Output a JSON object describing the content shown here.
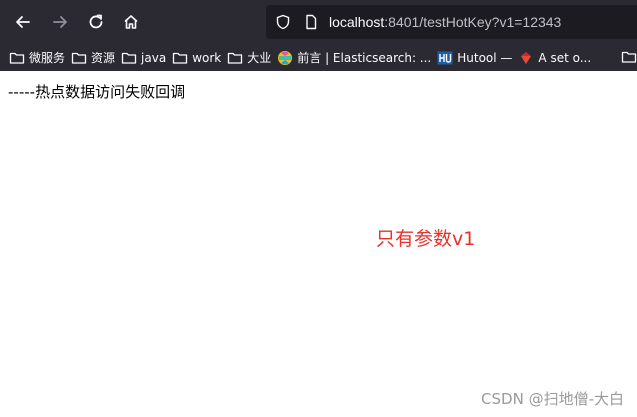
{
  "browser": {
    "url": {
      "host": "localhost",
      "rest": ":8401/testHotKey?v1=12343"
    },
    "icons": {
      "back": "arrow-left-icon",
      "forward": "arrow-right-icon",
      "reload": "reload-icon",
      "home": "home-icon",
      "tracking": "shield-icon",
      "page": "page-icon"
    },
    "bookmarks": [
      {
        "label": "微服务",
        "icon": "folder-icon"
      },
      {
        "label": "资源",
        "icon": "folder-icon"
      },
      {
        "label": "java",
        "icon": "folder-icon"
      },
      {
        "label": "work",
        "icon": "folder-icon"
      },
      {
        "label": "大业",
        "icon": "folder-icon"
      },
      {
        "label": "前言 | Elasticsearch: ...",
        "icon": "elasticsearch-icon"
      },
      {
        "label": "Hutool — ",
        "icon": "hutool-icon"
      },
      {
        "label": "A set o...",
        "icon": "ruby-icon"
      }
    ],
    "colors": {
      "chrome_bg": "#2b2a33",
      "urlbar_bg": "#1c1b22"
    }
  },
  "page": {
    "text": "-----热点数据访问失败回调"
  },
  "annotation": {
    "text": "只有参数v1",
    "color": "#e8312b"
  },
  "watermark": {
    "text": "CSDN @扫地僧-大白"
  }
}
